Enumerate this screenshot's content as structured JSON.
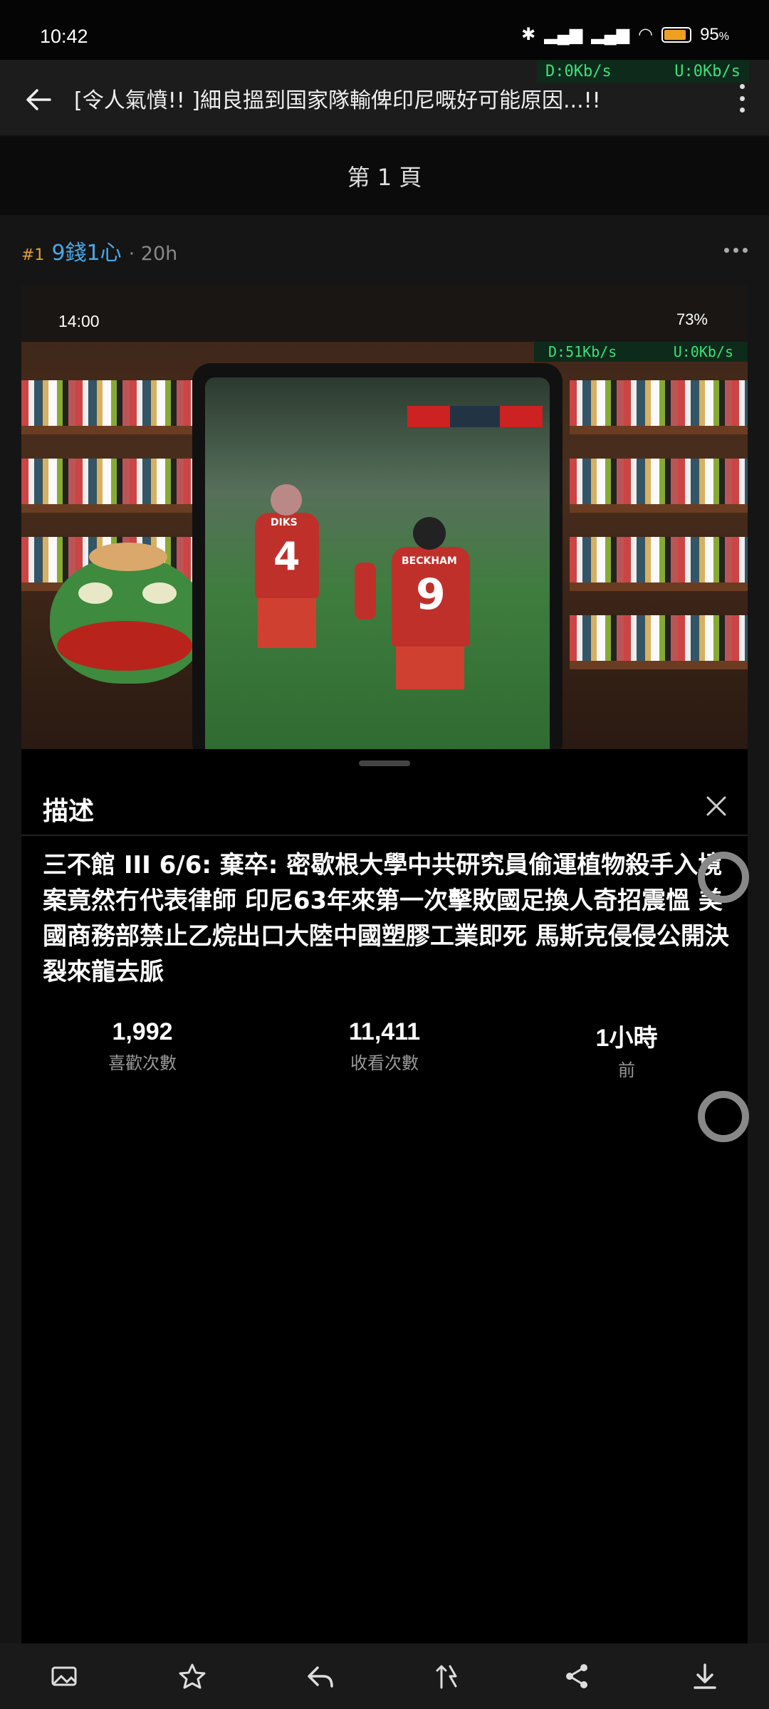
{
  "status_bar": {
    "time": "10:42",
    "battery": "95",
    "battery_unit": "%"
  },
  "net_speed": {
    "download": "D:0Kb/s",
    "upload": "U:0Kb/s"
  },
  "header": {
    "title": "[令人氣憤!! ]細良搵到国家隊輸俾印尼嘅好可能原因...!!"
  },
  "page": {
    "label": "第 1 頁"
  },
  "post": {
    "number": "#1",
    "author": "9錢1心",
    "age": "· 20h"
  },
  "video": {
    "status_time": "14:00",
    "status_battery": "73%",
    "speed_down": "D:51Kb/s",
    "speed_up": "U:0Kb/s",
    "jersey_left": "4",
    "jersey_right": "9",
    "name_left": "DIKS",
    "name_right": "BECKHAM"
  },
  "description": {
    "title": "描述",
    "text": "三不館 III 6/6: 棄卒: 密歇根大學中共研究員偷運植物殺手入境案竟然冇代表律師 印尼63年來第一次擊敗國足換人奇招震慍 美國商務部禁止乙烷出口大陸中國塑膠工業即死 馬斯克侵侵公開決裂來龍去脈",
    "stats": [
      {
        "value": "1,992",
        "label": "喜歡次數"
      },
      {
        "value": "11,411",
        "label": "收看次數"
      },
      {
        "value": "1小時",
        "label": "前"
      }
    ]
  },
  "bottom_bar": [
    "image-icon",
    "star-icon",
    "reply-icon",
    "sort-icon",
    "share-icon",
    "download-icon"
  ]
}
